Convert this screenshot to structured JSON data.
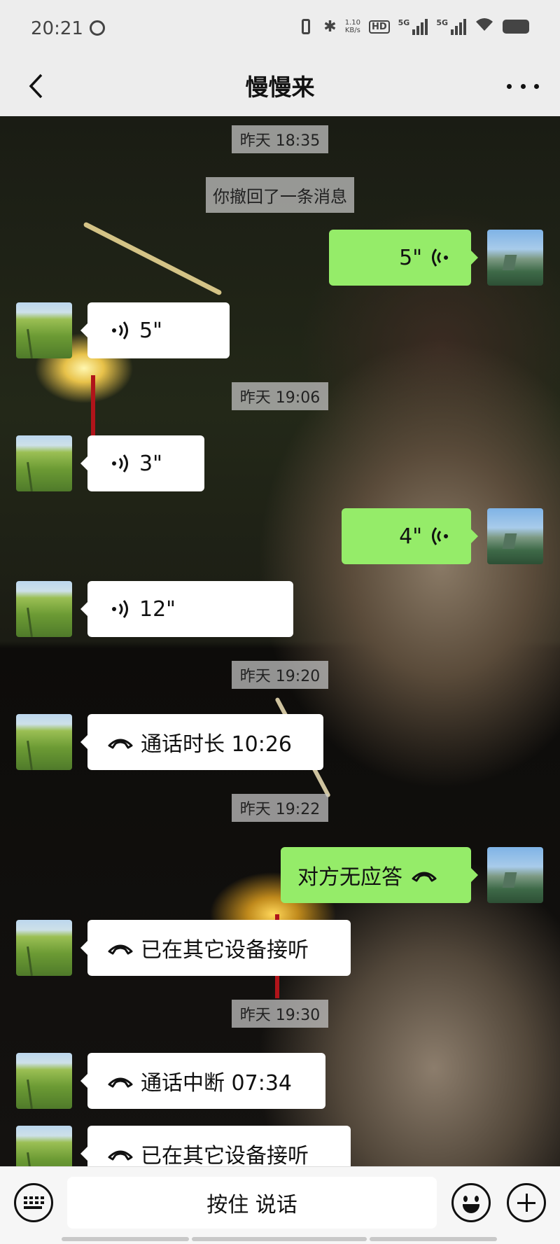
{
  "status_bar": {
    "time": "20:21",
    "net_speed_value": "1.10",
    "net_speed_unit": "KB/s",
    "hd_label": "HD",
    "sig1_label": "5G",
    "sig2_label": "5G"
  },
  "header": {
    "title": "慢慢来"
  },
  "messages": {
    "ts_1": "昨天 18:35",
    "system_recall": "你撤回了一条消息",
    "voice_sent_1": "5\"",
    "voice_recv_1": "5\"",
    "ts_2": "昨天 19:06",
    "voice_recv_2": "3\"",
    "voice_sent_2": "4\"",
    "voice_recv_3": "12\"",
    "ts_3": "昨天 19:20",
    "call_recv_1": "通话时长 10:26",
    "ts_4": "昨天 19:22",
    "call_sent_1": "对方无应答",
    "call_recv_2": "已在其它设备接听",
    "ts_5": "昨天 19:30",
    "call_recv_3": "通话中断 07:34",
    "call_recv_4": "已在其它设备接听"
  },
  "input_bar": {
    "talk_label": "按住 说话"
  },
  "colors": {
    "sent_bubble": "#95ec69",
    "received_bubble": "#ffffff",
    "header_bg": "#ededed"
  }
}
